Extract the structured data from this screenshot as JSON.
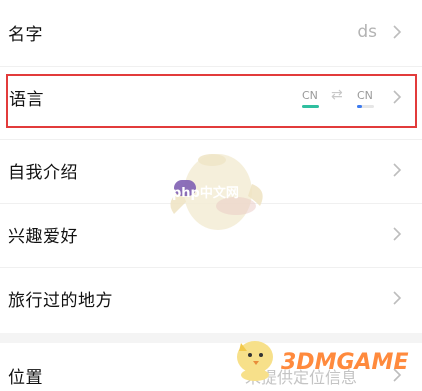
{
  "rows": {
    "name": {
      "label": "名字",
      "value": "ds"
    },
    "language": {
      "label": "语言",
      "from": "CN",
      "to": "CN",
      "swap_symbol": "⇄"
    },
    "intro": {
      "label": "自我介绍"
    },
    "hobby": {
      "label": "兴趣爱好"
    },
    "travel": {
      "label": "旅行过的地方"
    },
    "location": {
      "label": "位置",
      "hint": "未提供定位信息"
    }
  },
  "watermarks": {
    "php": "php中文网",
    "game": "3DMGAME"
  },
  "colors": {
    "highlight": "#e23b3b",
    "from_bar": "#2fbf9f",
    "to_bar": "#3c7bf0"
  }
}
